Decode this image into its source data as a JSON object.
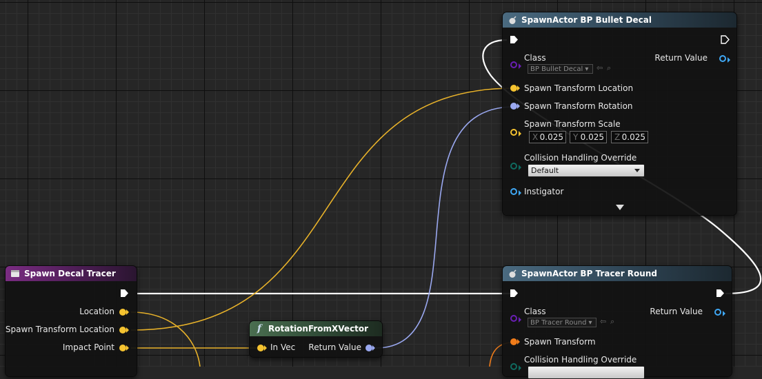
{
  "nodes": {
    "spawn_decal": {
      "title": "SpawnActor BP Bullet Decal",
      "class_label": "Class",
      "class_value": "BP Bullet Decal",
      "return_label": "Return Value",
      "pin_location": "Spawn Transform Location",
      "pin_rotation": "Spawn Transform Rotation",
      "pin_scale": "Spawn Transform Scale",
      "scale": {
        "x_label": "X",
        "x": "0.025",
        "y_label": "Y",
        "y": "0.025",
        "z_label": "Z",
        "z": "0.025"
      },
      "collision_label": "Collision Handling Override",
      "collision_value": "Default",
      "instigator_label": "Instigator"
    },
    "spawn_tracer_event": {
      "title": "Spawn Decal Tracer",
      "pin_location": "Location",
      "pin_spawn_location": "Spawn Transform Location",
      "pin_impact": "Impact Point"
    },
    "rotation_from_x": {
      "title": "RotationFromXVector",
      "in_label": "In Vec",
      "return_label": "Return Value"
    },
    "spawn_tracer_round": {
      "title": "SpawnActor BP Tracer Round",
      "class_label": "Class",
      "class_value": "BP Tracer Round",
      "return_label": "Return Value",
      "pin_transform": "Spawn Transform",
      "collision_label": "Collision Handling Override"
    }
  },
  "colors": {
    "background": "#262626",
    "exec_wire": "#ffffff",
    "vector_pin": "#f5c330",
    "rotator_pin": "#9aa8f0",
    "transform_pin": "#f07c1a",
    "object_pin": "#3fa8f5",
    "class_pin": "#6a1fb5",
    "enum_pin": "#0f6b60"
  }
}
